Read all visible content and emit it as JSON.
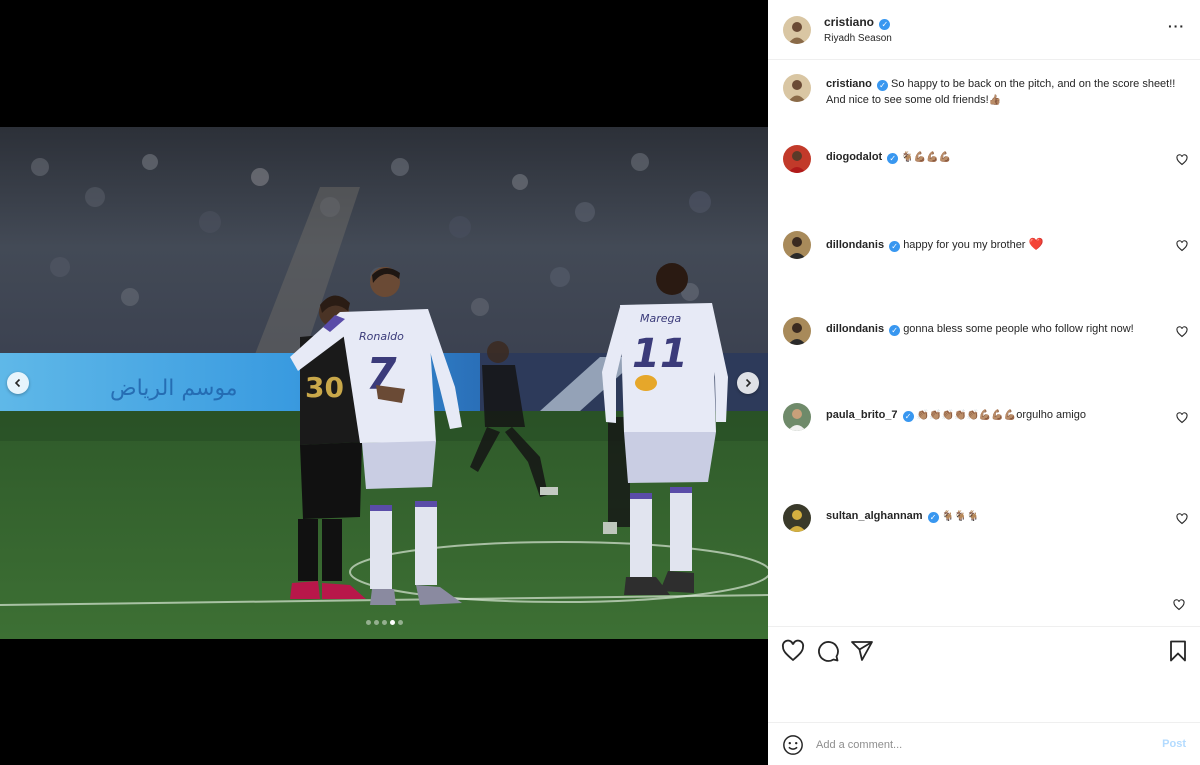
{
  "post": {
    "username": "cristiano",
    "location": "Riyadh Season",
    "caption": "So happy to be back on the pitch, and on the score sheet!! And nice to see some old friends!",
    "caption_emoji": "👍🏽"
  },
  "media": {
    "jersey_left": "30",
    "jersey_center_name": "Ronaldo",
    "jersey_center_number": "7",
    "jersey_right_name": "Marega",
    "jersey_right_number": "11",
    "carousel_total": 5,
    "carousel_active": 4
  },
  "comments": [
    {
      "username": "diogodalot",
      "text": "",
      "emoji": "🐐💪🏽💪🏽💪🏽"
    },
    {
      "username": "dillondanis",
      "text": "happy for you my brother",
      "emoji": "❤️"
    },
    {
      "username": "dillondanis",
      "text": "gonna bless some people who follow right now!",
      "emoji": ""
    },
    {
      "username": "paula_brito_7",
      "text": "orgulho amigo",
      "emoji": "👏🏽👏🏽👏🏽👏🏽👏🏽💪🏽💪🏽💪🏽"
    },
    {
      "username": "sultan_alghannam",
      "text": "",
      "emoji": "🐐🐐🐐"
    }
  ],
  "add_comment": {
    "placeholder": "Add a comment...",
    "post_label": "Post"
  },
  "colors": {
    "verified": "#3897f0",
    "post_disabled": "#b3dbff",
    "heart_red": "#ed1c24"
  },
  "icons": [
    "chevron-left-icon",
    "chevron-right-icon",
    "more-options-icon",
    "heart-icon",
    "comment-icon",
    "share-icon",
    "bookmark-icon",
    "smiley-icon",
    "verified-badge-icon"
  ]
}
